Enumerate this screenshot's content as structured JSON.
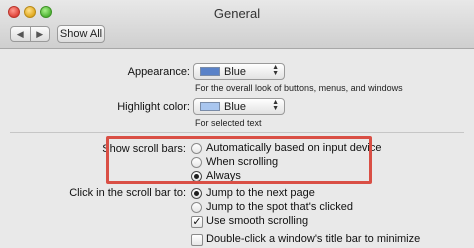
{
  "window": {
    "title": "General"
  },
  "toolbar": {
    "back_glyph": "◀",
    "forward_glyph": "▶",
    "show_all_label": "Show All"
  },
  "appearance": {
    "label": "Appearance:",
    "selected": "Blue",
    "description": "For the overall look of buttons, menus, and windows",
    "swatch_color": "#5a82c8"
  },
  "highlight_color": {
    "label": "Highlight color:",
    "selected": "Blue",
    "description": "For selected text",
    "swatch_color": "#a9c6ef"
  },
  "scroll_bars": {
    "label": "Show scroll bars:",
    "options": [
      {
        "label": "Automatically based on input device",
        "selected": false
      },
      {
        "label": "When scrolling",
        "selected": false
      },
      {
        "label": "Always",
        "selected": true
      }
    ],
    "annotation_color": "#d94f45"
  },
  "click_scroll": {
    "label": "Click in the scroll bar to:",
    "options": [
      {
        "label": "Jump to the next page",
        "selected": true
      },
      {
        "label": "Jump to the spot that's clicked",
        "selected": false
      }
    ]
  },
  "checkboxes": [
    {
      "label": "Use smooth scrolling",
      "checked": true,
      "mark": "✓"
    },
    {
      "label": "Double-click a window's title bar to minimize",
      "checked": false,
      "mark": ""
    }
  ]
}
